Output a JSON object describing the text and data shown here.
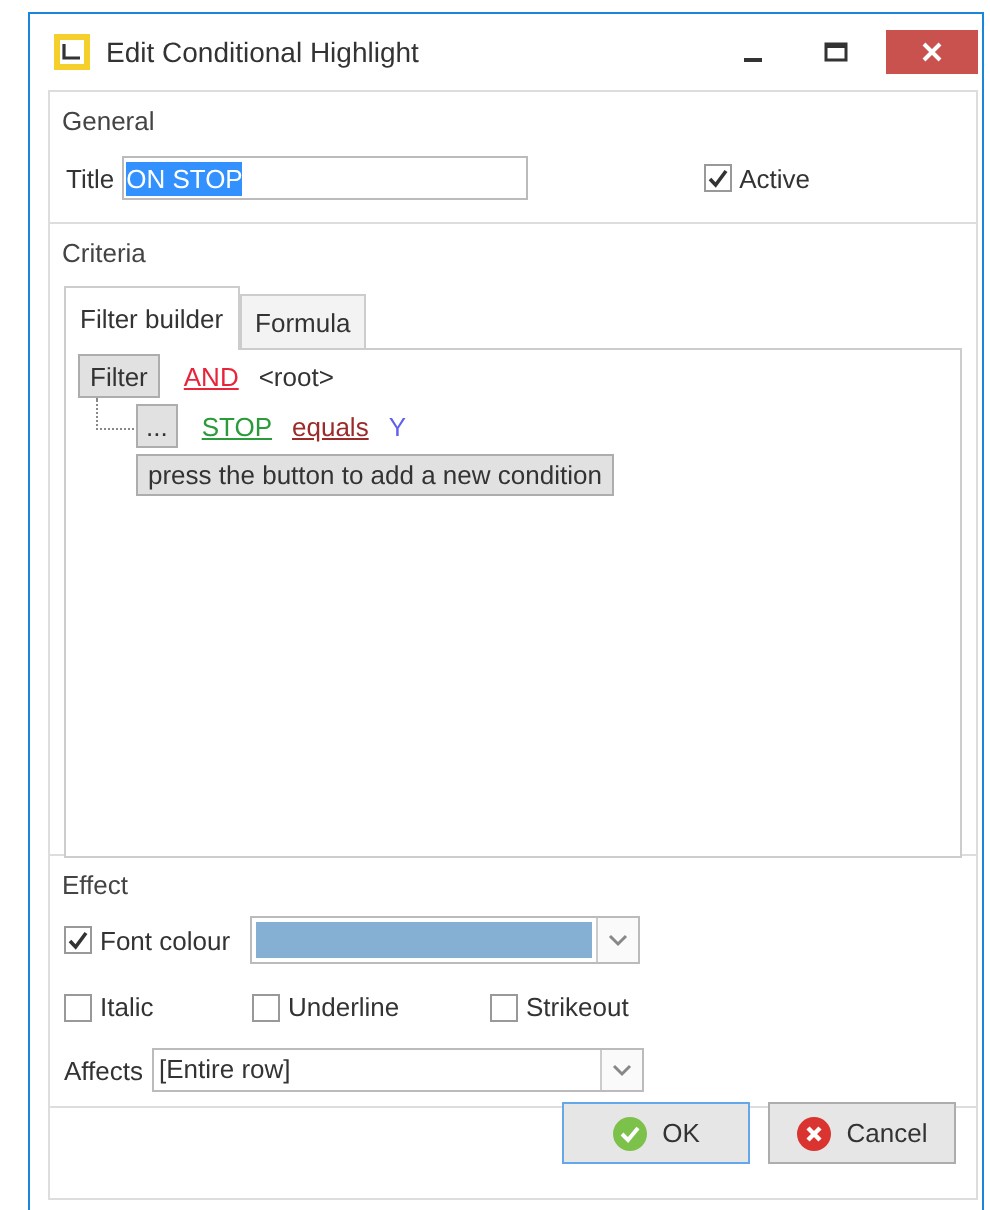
{
  "window": {
    "title": "Edit Conditional Highlight"
  },
  "general": {
    "label": "General",
    "title_field": {
      "label": "Title",
      "value": "ON STOP",
      "selected": true
    },
    "active": {
      "label": "Active",
      "checked": true
    }
  },
  "criteria": {
    "label": "Criteria",
    "tabs": [
      {
        "label": "Filter builder",
        "selected": true
      },
      {
        "label": "Formula",
        "selected": false
      }
    ],
    "filter": {
      "button": "Filter",
      "operator": "AND",
      "group": "<root>",
      "conditions": [
        {
          "button": "...",
          "field": "STOP",
          "op": "equals",
          "value": "Y"
        }
      ],
      "add_hint": "press the button to add a new condition"
    }
  },
  "effect": {
    "label": "Effect",
    "font_colour": {
      "label": "Font colour",
      "checked": true,
      "color": "#86afd4"
    },
    "styles": [
      {
        "label": "Italic",
        "checked": false
      },
      {
        "label": "Underline",
        "checked": false
      },
      {
        "label": "Strikeout",
        "checked": false
      }
    ],
    "affects": {
      "label": "Affects",
      "value": "[Entire row]"
    }
  },
  "buttons": [
    {
      "label": "OK",
      "kind": "ok",
      "focused": true
    },
    {
      "label": "Cancel",
      "kind": "cancel",
      "focused": false
    }
  ]
}
